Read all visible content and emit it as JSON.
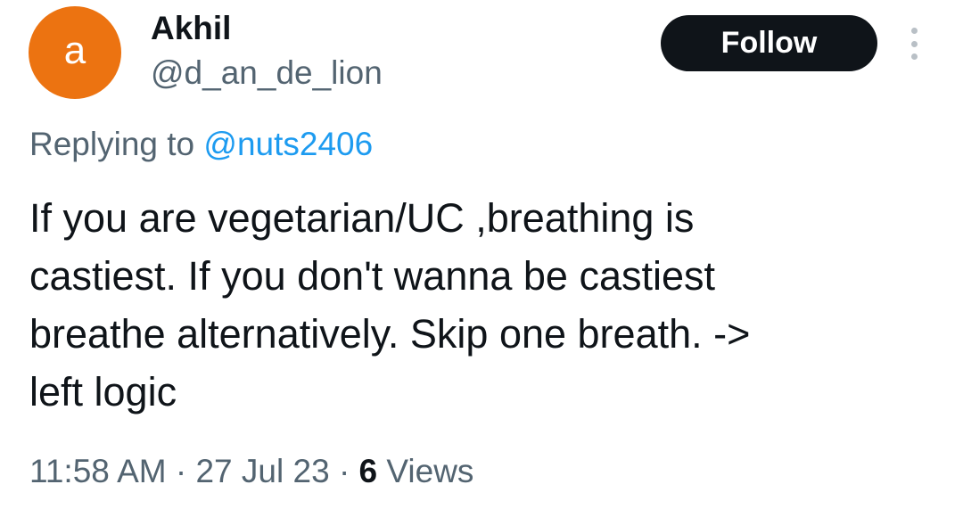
{
  "author": {
    "avatar_letter": "a",
    "avatar_color": "#ec7311",
    "display_name": "Akhil",
    "handle": "@d_an_de_lion"
  },
  "actions": {
    "follow_label": "Follow",
    "more_icon": "more-vertical-icon"
  },
  "reply": {
    "prefix": "Replying to ",
    "mention": "@nuts2406"
  },
  "tweet": {
    "lines": [
      "If you are vegetarian/UC ,breathing is",
      "castiest. If you don't wanna be castiest",
      "breathe alternatively. Skip one breath. ->",
      "left logic"
    ]
  },
  "meta": {
    "time": "11:58 AM",
    "separator": "·",
    "date": "27 Jul 23",
    "views_count": "6",
    "views_label": "Views"
  },
  "colors": {
    "text_primary": "#0f1419",
    "text_secondary": "#536471",
    "link": "#1d9bf0",
    "follow_bg": "#0f1419"
  }
}
